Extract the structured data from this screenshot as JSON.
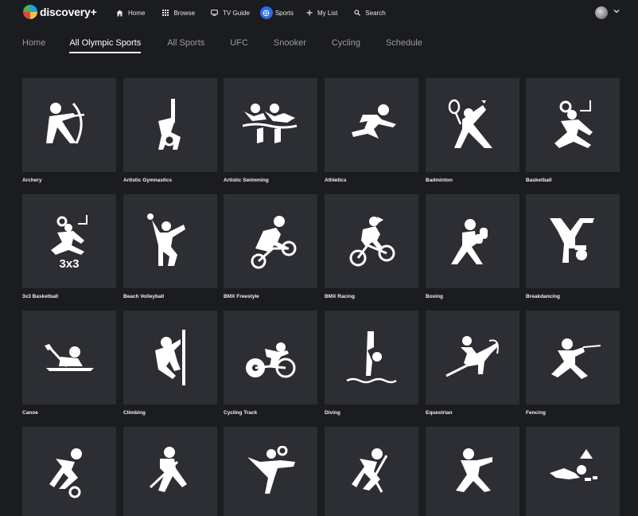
{
  "brand": {
    "name": "discovery+"
  },
  "nav": {
    "home": "Home",
    "browse": "Browse",
    "tv_guide": "TV Guide",
    "sports": "Sports",
    "my_list": "My List",
    "search": "Search"
  },
  "subtabs": [
    {
      "label": "Home",
      "active": false
    },
    {
      "label": "All Olympic Sports",
      "active": true
    },
    {
      "label": "All Sports",
      "active": false
    },
    {
      "label": "UFC",
      "active": false
    },
    {
      "label": "Snooker",
      "active": false
    },
    {
      "label": "Cycling",
      "active": false
    },
    {
      "label": "Schedule",
      "active": false
    }
  ],
  "sports": [
    {
      "label": "Archery",
      "icon": "archery-icon"
    },
    {
      "label": "Artistic Gymnastics",
      "icon": "artistic-gymnastics-icon"
    },
    {
      "label": "Artistic Swimming",
      "icon": "artistic-swimming-icon"
    },
    {
      "label": "Athletics",
      "icon": "athletics-icon"
    },
    {
      "label": "Badminton",
      "icon": "badminton-icon"
    },
    {
      "label": "Basketball",
      "icon": "basketball-icon"
    },
    {
      "label": "3x3 Basketball",
      "icon": "3x3-basketball-icon"
    },
    {
      "label": "Beach Volleyball",
      "icon": "beach-volleyball-icon"
    },
    {
      "label": "BMX Freestyle",
      "icon": "bmx-freestyle-icon"
    },
    {
      "label": "BMX Racing",
      "icon": "bmx-racing-icon"
    },
    {
      "label": "Boxing",
      "icon": "boxing-icon"
    },
    {
      "label": "Breakdancing",
      "icon": "breakdancing-icon"
    },
    {
      "label": "Canoe",
      "icon": "canoe-icon"
    },
    {
      "label": "Climbing",
      "icon": "climbing-icon"
    },
    {
      "label": "Cycling Track",
      "icon": "cycling-track-icon"
    },
    {
      "label": "Diving",
      "icon": "diving-icon"
    },
    {
      "label": "Equestrian",
      "icon": "equestrian-icon"
    },
    {
      "label": "Fencing",
      "icon": "fencing-icon"
    },
    {
      "label": "",
      "icon": "football-icon"
    },
    {
      "label": "",
      "icon": "golf-icon"
    },
    {
      "label": "",
      "icon": "handball-icon"
    },
    {
      "label": "",
      "icon": "hockey-icon"
    },
    {
      "label": "",
      "icon": "judo-icon"
    },
    {
      "label": "",
      "icon": "marathon-swimming-icon"
    }
  ],
  "colors": {
    "background": "#1b1c20",
    "tile": "#2c2e33",
    "accent": "#2c6be5",
    "inactive_tab": "#9a9ba1"
  }
}
